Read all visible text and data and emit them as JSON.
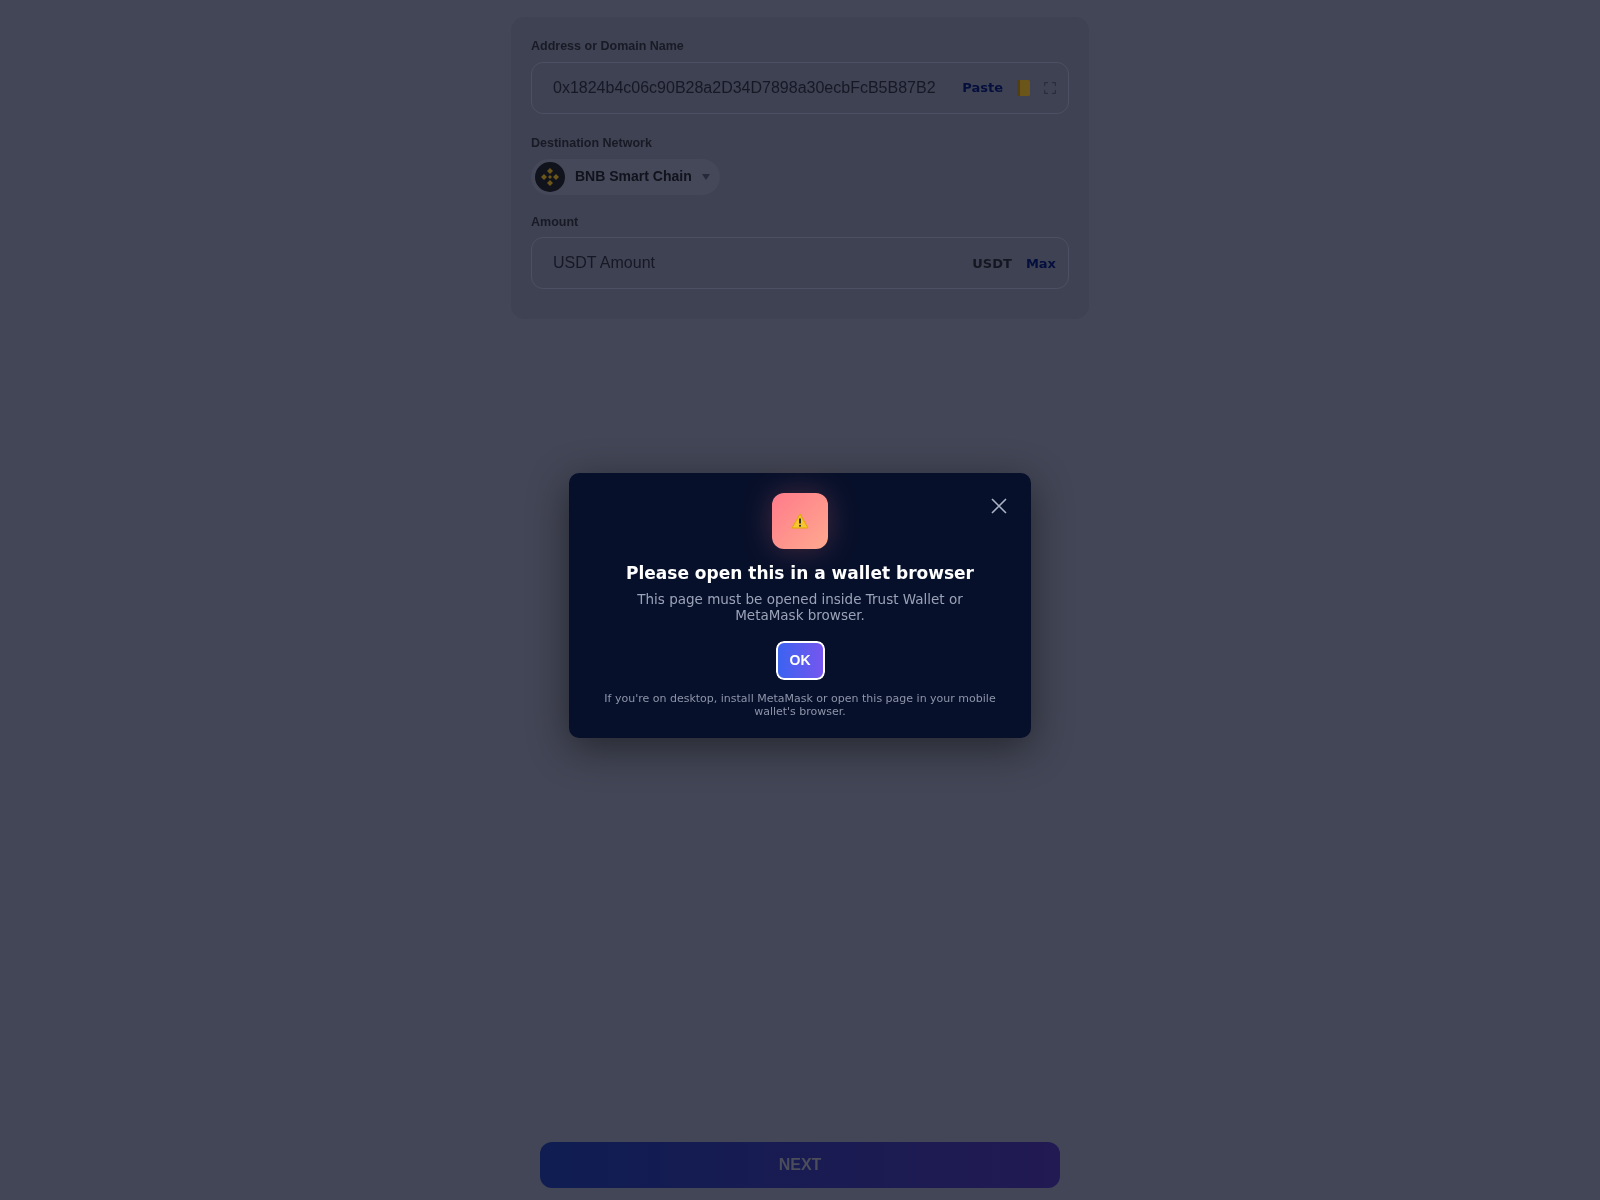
{
  "form": {
    "address": {
      "label": "Address or Domain Name",
      "value": "0x1824b4c06c90B28a2D34D7898a30ecbFcB5B87B2",
      "paste": "Paste"
    },
    "network": {
      "label": "Destination Network",
      "name": "BNB Smart Chain"
    },
    "amount": {
      "label": "Amount",
      "placeholder": "USDT Amount",
      "unit": "USDT",
      "max": "Max"
    }
  },
  "modal": {
    "title": "Please open this in a wallet browser",
    "message": "This page must be opened inside Trust Wallet or MetaMask browser.",
    "button": "OK",
    "note": "If you're on desktop, install MetaMask or open this page in your mobile wallet's browser."
  },
  "next_button": {
    "label": "NEXT",
    "disabled": true
  }
}
